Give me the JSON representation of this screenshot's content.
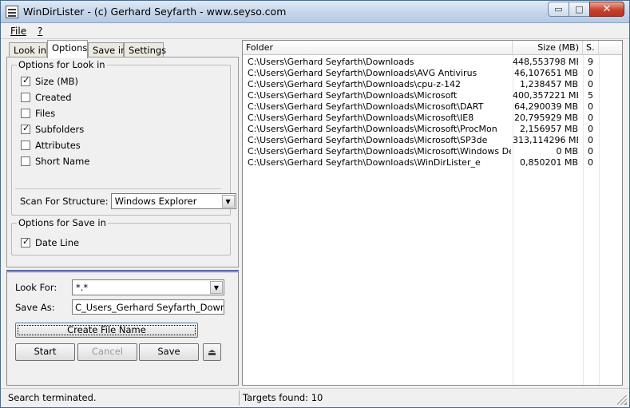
{
  "window": {
    "title": "WinDirLister - (c) Gerhard Seyfarth - www.seyso.com",
    "minimize": "▭",
    "maximize": "□",
    "close": "✕"
  },
  "menu": [
    {
      "label": "File"
    },
    {
      "label": "?"
    }
  ],
  "tabs": [
    {
      "label": "Look in"
    },
    {
      "label": "Options"
    },
    {
      "label": "Save in"
    },
    {
      "label": "Settings"
    }
  ],
  "active_tab": "Options",
  "options_look_in": {
    "legend": "Options for Look in",
    "checkboxes": [
      {
        "label": "Size (MB)",
        "checked": true
      },
      {
        "label": "Created",
        "checked": false
      },
      {
        "label": "Files",
        "checked": false
      },
      {
        "label": "Subfolders",
        "checked": true
      },
      {
        "label": "Attributes",
        "checked": false
      },
      {
        "label": "Short Name",
        "checked": false
      }
    ],
    "scan_label": "Scan For Structure:",
    "scan_value": "Windows Explorer"
  },
  "options_save_in": {
    "legend": "Options for Save in",
    "checkboxes": [
      {
        "label": "Date Line",
        "checked": true
      }
    ]
  },
  "lower": {
    "look_for_label": "Look For:",
    "look_for_value": "*.*",
    "save_as_label": "Save As:",
    "save_as_value": "C_Users_Gerhard Seyfarth_Downloads_",
    "create_button": "Create File Name",
    "start_button": "Start",
    "cancel_button": "Cancel",
    "save_button": "Save",
    "eject_glyph": "⏏"
  },
  "list": {
    "columns": [
      "Folder",
      "Size (MB)",
      "S."
    ],
    "rows": [
      {
        "folder": "C:\\Users\\Gerhard Seyfarth\\Downloads",
        "size": "448,553798 MB",
        "s": "9"
      },
      {
        "folder": "C:\\Users\\Gerhard Seyfarth\\Downloads\\AVG Antivirus",
        "size": "46,107651 MB",
        "s": "0"
      },
      {
        "folder": "C:\\Users\\Gerhard Seyfarth\\Downloads\\cpu-z-142",
        "size": "1,238457 MB",
        "s": "0"
      },
      {
        "folder": "C:\\Users\\Gerhard Seyfarth\\Downloads\\Microsoft",
        "size": "400,357221 MB",
        "s": "5"
      },
      {
        "folder": "C:\\Users\\Gerhard Seyfarth\\Downloads\\Microsoft\\DART",
        "size": "64,290039 MB",
        "s": "0"
      },
      {
        "folder": "C:\\Users\\Gerhard Seyfarth\\Downloads\\Microsoft\\IE8",
        "size": "20,795929 MB",
        "s": "0"
      },
      {
        "folder": "C:\\Users\\Gerhard Seyfarth\\Downloads\\Microsoft\\ProcMon",
        "size": "2,156957 MB",
        "s": "0"
      },
      {
        "folder": "C:\\Users\\Gerhard Seyfarth\\Downloads\\Microsoft\\SP3de",
        "size": "313,114296 MB",
        "s": "0"
      },
      {
        "folder": "C:\\Users\\Gerhard Seyfarth\\Downloads\\Microsoft\\Windows Defender",
        "size": "0 MB",
        "s": "0"
      },
      {
        "folder": "C:\\Users\\Gerhard Seyfarth\\Downloads\\WinDirLister_e",
        "size": "0,850201 MB",
        "s": "0"
      }
    ]
  },
  "status": {
    "left": "Search terminated.",
    "right": "Targets found: 10"
  },
  "colors": {
    "selection_border": "#2a3a8a",
    "close_button": "#c8412c"
  }
}
